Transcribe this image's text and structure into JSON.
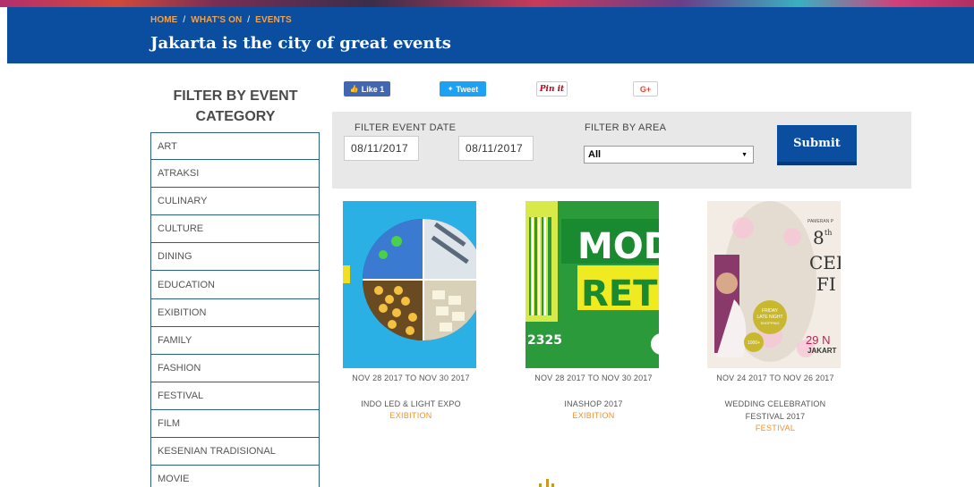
{
  "breadcrumb": {
    "home": "HOME",
    "whats_on": "WHAT'S ON",
    "events": "EVENTS",
    "sep": "/"
  },
  "hero": {
    "title": "Jakarta is the city of great events"
  },
  "sidebar": {
    "heading": "FILTER BY EVENT CATEGORY",
    "items": [
      {
        "label": "ART"
      },
      {
        "label": "ATRAKSI"
      },
      {
        "label": "CULINARY"
      },
      {
        "label": "CULTURE"
      },
      {
        "label": "DINING"
      },
      {
        "label": "EDUCATION"
      },
      {
        "label": "EXIBITION"
      },
      {
        "label": "FAMILY"
      },
      {
        "label": "FASHION"
      },
      {
        "label": "FESTIVAL"
      },
      {
        "label": "FILM"
      },
      {
        "label": "KESENIAN TRADISIONAL"
      },
      {
        "label": "MOVIE"
      }
    ]
  },
  "share": {
    "facebook": "Like 1",
    "twitter": "Tweet",
    "pinterest": "Pin it",
    "google": "G+"
  },
  "filters": {
    "date_label": "FILTER EVENT DATE",
    "date_from": "08/11/2017",
    "date_to": "08/11/2017",
    "area_label": "FILTER BY AREA",
    "area_value": "All",
    "submit": "Submit"
  },
  "thumb_text": {
    "modern_top": "MOD",
    "modern_bottom": "RET",
    "modern_num": "2325",
    "wed_tag": "PAMERAN P",
    "wed_big1": "8",
    "wed_sup": "th",
    "wed_big2": "CEI",
    "wed_big3": "FI",
    "wed_badge1": "FRIDAY",
    "wed_badge2": "LATE NIGHT",
    "wed_badge3": "SHOPPING",
    "wed_badge4": "1000+",
    "wed_date": "29 N",
    "wed_city": "JAKART"
  },
  "events": [
    {
      "date": "NOV 28 2017 TO NOV 30 2017",
      "name": "INDO LED & LIGHT EXPO",
      "category": "EXIBITION"
    },
    {
      "date": "NOV 28 2017 TO NOV 30 2017",
      "name": "INASHOP 2017",
      "category": "EXIBITION"
    },
    {
      "date": "NOV 24 2017 TO NOV 26 2017",
      "name": "WEDDING CELEBRATION FESTIVAL 2017",
      "category": "FESTIVAL"
    }
  ],
  "colors": {
    "brand_blue": "#0b4ea0",
    "accent_orange": "#f0932b",
    "breadcrumb_orange": "#f2a24a"
  }
}
